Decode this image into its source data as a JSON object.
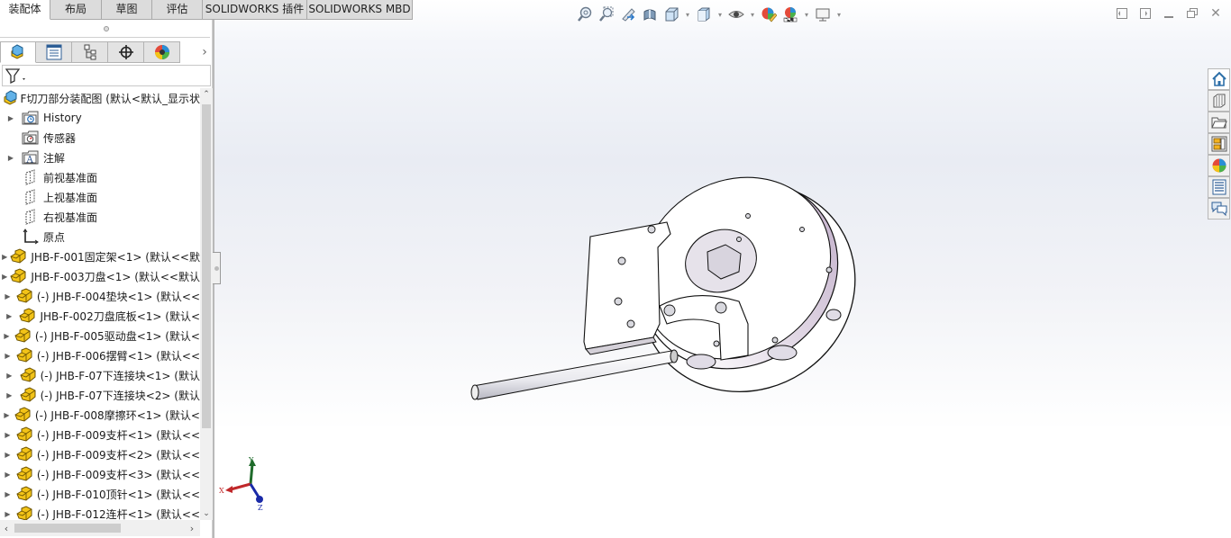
{
  "command_tabs": [
    {
      "label": "装配体",
      "active": true
    },
    {
      "label": "布局",
      "active": false
    },
    {
      "label": "草图",
      "active": false
    },
    {
      "label": "评估",
      "active": false
    },
    {
      "label": "SOLIDWORKS 插件",
      "active": false
    },
    {
      "label": "SOLIDWORKS MBD",
      "active": false
    }
  ],
  "heads_up_toolbar": [
    {
      "icon": "zoom-to-fit-icon"
    },
    {
      "icon": "zoom-to-area-icon"
    },
    {
      "icon": "previous-view-icon"
    },
    {
      "icon": "section-view-icon"
    },
    {
      "icon": "view-orientation-icon",
      "dropdown": true
    },
    {
      "icon": "display-style-icon",
      "dropdown": true
    },
    {
      "icon": "hide-show-items-icon",
      "dropdown": true
    },
    {
      "icon": "edit-appearance-icon"
    },
    {
      "icon": "apply-scene-icon",
      "dropdown": true
    },
    {
      "icon": "view-settings-icon",
      "dropdown": true
    }
  ],
  "window_controls": {
    "tile_left": "◧",
    "tile_right": "◨",
    "minimize": "—",
    "restore": "❐",
    "close": "✕"
  },
  "feature_manager": {
    "tabs": [
      {
        "name": "featuremanager-tab",
        "icon": "assembly-icon",
        "active": true
      },
      {
        "name": "propertymanager-tab",
        "icon": "property-list-icon",
        "active": false
      },
      {
        "name": "configurationmanager-tab",
        "icon": "configuration-icon",
        "active": false
      },
      {
        "name": "dimxpertmanager-tab",
        "icon": "crosshair-icon",
        "active": false
      },
      {
        "name": "displaymanager-tab",
        "icon": "appearance-icon",
        "active": false
      }
    ],
    "more_tabs": "›",
    "filter_icon": "filter-icon",
    "root": {
      "label": "F切刀部分装配图  (默认<默认_显示状"
    },
    "items": [
      {
        "label": "History",
        "icon": "history-folder-icon",
        "expandable": true
      },
      {
        "label": "传感器",
        "icon": "sensors-folder-icon",
        "expandable": false
      },
      {
        "label": "注解",
        "icon": "annotations-folder-icon",
        "expandable": true
      },
      {
        "label": "前视基准面",
        "icon": "plane-icon",
        "expandable": false
      },
      {
        "label": "上视基准面",
        "icon": "plane-icon",
        "expandable": false
      },
      {
        "label": "右视基准面",
        "icon": "plane-icon",
        "expandable": false
      },
      {
        "label": "原点",
        "icon": "origin-icon",
        "expandable": false
      },
      {
        "label": "JHB-F-001固定架<1> (默认<<默",
        "icon": "part-icon",
        "expandable": true
      },
      {
        "label": "JHB-F-003刀盘<1> (默认<<默认",
        "icon": "part-icon",
        "expandable": true
      },
      {
        "label": "(-) JHB-F-004垫块<1> (默认<<",
        "icon": "part-icon",
        "expandable": true
      },
      {
        "label": "JHB-F-002刀盘底板<1> (默认<",
        "icon": "part-icon",
        "expandable": true
      },
      {
        "label": "(-) JHB-F-005驱动盘<1> (默认<",
        "icon": "part-icon",
        "expandable": true
      },
      {
        "label": "(-) JHB-F-006摆臂<1> (默认<<",
        "icon": "part-icon",
        "expandable": true
      },
      {
        "label": "(-) JHB-F-07下连接块<1> (默认",
        "icon": "part-icon",
        "expandable": true
      },
      {
        "label": "(-) JHB-F-07下连接块<2> (默认",
        "icon": "part-icon",
        "expandable": true
      },
      {
        "label": "(-) JHB-F-008摩擦环<1> (默认<",
        "icon": "part-icon",
        "expandable": true
      },
      {
        "label": "(-) JHB-F-009支杆<1> (默认<<",
        "icon": "part-icon",
        "expandable": true
      },
      {
        "label": "(-) JHB-F-009支杆<2> (默认<<",
        "icon": "part-icon",
        "expandable": true
      },
      {
        "label": "(-) JHB-F-009支杆<3> (默认<<",
        "icon": "part-icon",
        "expandable": true
      },
      {
        "label": "(-) JHB-F-010顶针<1> (默认<<",
        "icon": "part-icon",
        "expandable": true
      },
      {
        "label": "(-) JHB-F-012连杆<1> (默认<<",
        "icon": "part-icon",
        "expandable": true
      }
    ]
  },
  "task_pane": [
    {
      "icon": "solidworks-resources-icon"
    },
    {
      "icon": "design-library-icon"
    },
    {
      "icon": "file-explorer-icon"
    },
    {
      "icon": "view-palette-icon"
    },
    {
      "icon": "appearances-scenes-icon"
    },
    {
      "icon": "custom-properties-icon"
    },
    {
      "icon": "forum-icon"
    }
  ],
  "triad": {
    "x": "X",
    "y": "Y",
    "z": "Z"
  },
  "colors": {
    "tab_active": "#ffffff",
    "tab_inactive": "#dcdcdc",
    "part_icon": "#f2c318",
    "axis_x": "#c0282a",
    "axis_y": "#1f6b2b",
    "axis_z": "#1a2aa8"
  }
}
